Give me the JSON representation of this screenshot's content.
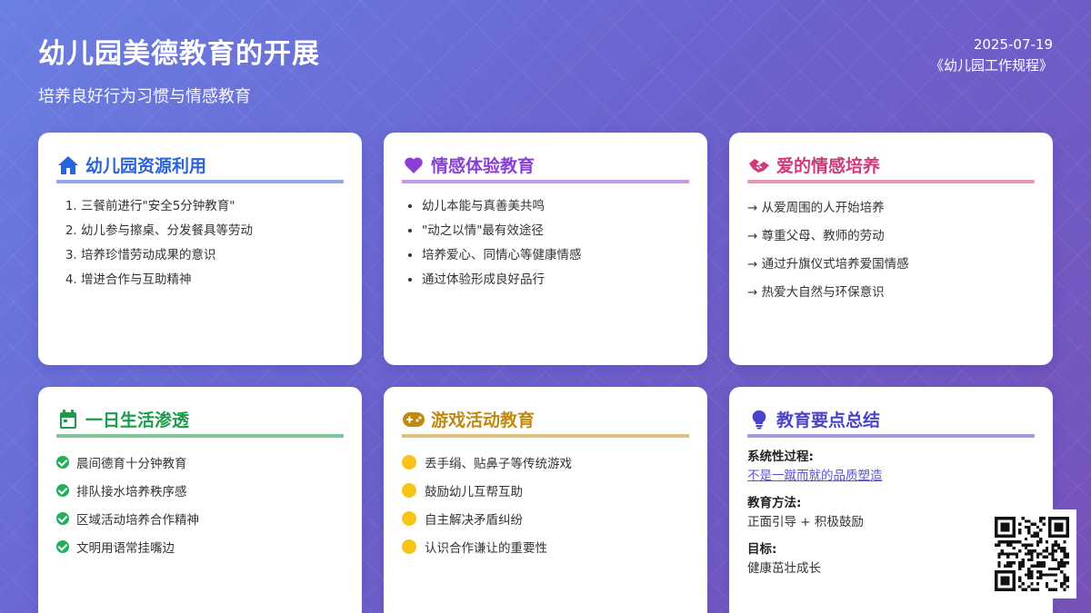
{
  "header": {
    "title": "幼儿园美德教育的开展",
    "subtitle": "培养良好行为习惯与情感教育",
    "date": "2025-07-19",
    "source": "《幼儿园工作规程》"
  },
  "cards": {
    "resources": {
      "title": "幼儿园资源利用",
      "icon": "home-icon",
      "items": [
        "三餐前进行\"安全5分钟教育\"",
        "幼儿参与擦桌、分发餐具等劳动",
        "培养珍惜劳动成果的意识",
        "增进合作与互助精神"
      ]
    },
    "emotion": {
      "title": "情感体验教育",
      "icon": "heart-icon",
      "items": [
        "幼儿本能与真善美共鸣",
        "\"动之以情\"最有效途径",
        "培养爱心、同情心等健康情感",
        "通过体验形成良好品行"
      ]
    },
    "love": {
      "title": "爱的情感培养",
      "icon": "handshake-icon",
      "items": [
        "→ 从爱周围的人开始培养",
        "→ 尊重父母、教师的劳动",
        "→ 通过升旗仪式培养爱国情感",
        "→ 热爱大自然与环保意识"
      ]
    },
    "daily": {
      "title": "一日生活渗透",
      "icon": "calendar-icon",
      "items": [
        "晨间德育十分钟教育",
        "排队接水培养秩序感",
        "区域活动培养合作精神",
        "文明用语常挂嘴边"
      ]
    },
    "games": {
      "title": "游戏活动教育",
      "icon": "gamepad-icon",
      "items": [
        "丢手绢、贴鼻子等传统游戏",
        "鼓励幼儿互帮互助",
        "自主解决矛盾纠纷",
        "认识合作谦让的重要性"
      ]
    },
    "summary": {
      "title": "教育要点总结",
      "icon": "lightbulb-icon",
      "label1": "系统性过程:",
      "value1": "不是一蹴而就的品质塑造",
      "label2": "教育方法:",
      "value2": "正面引导 + 积极鼓励",
      "label3": "目标:",
      "value3": "健康茁壮成长"
    }
  },
  "colors": {
    "blue": "#2b63d8",
    "purple": "#8b3fd6",
    "pink": "#d03a7a",
    "green": "#1e9a4b",
    "gold": "#c08a12",
    "indigo": "#4a45c8"
  }
}
